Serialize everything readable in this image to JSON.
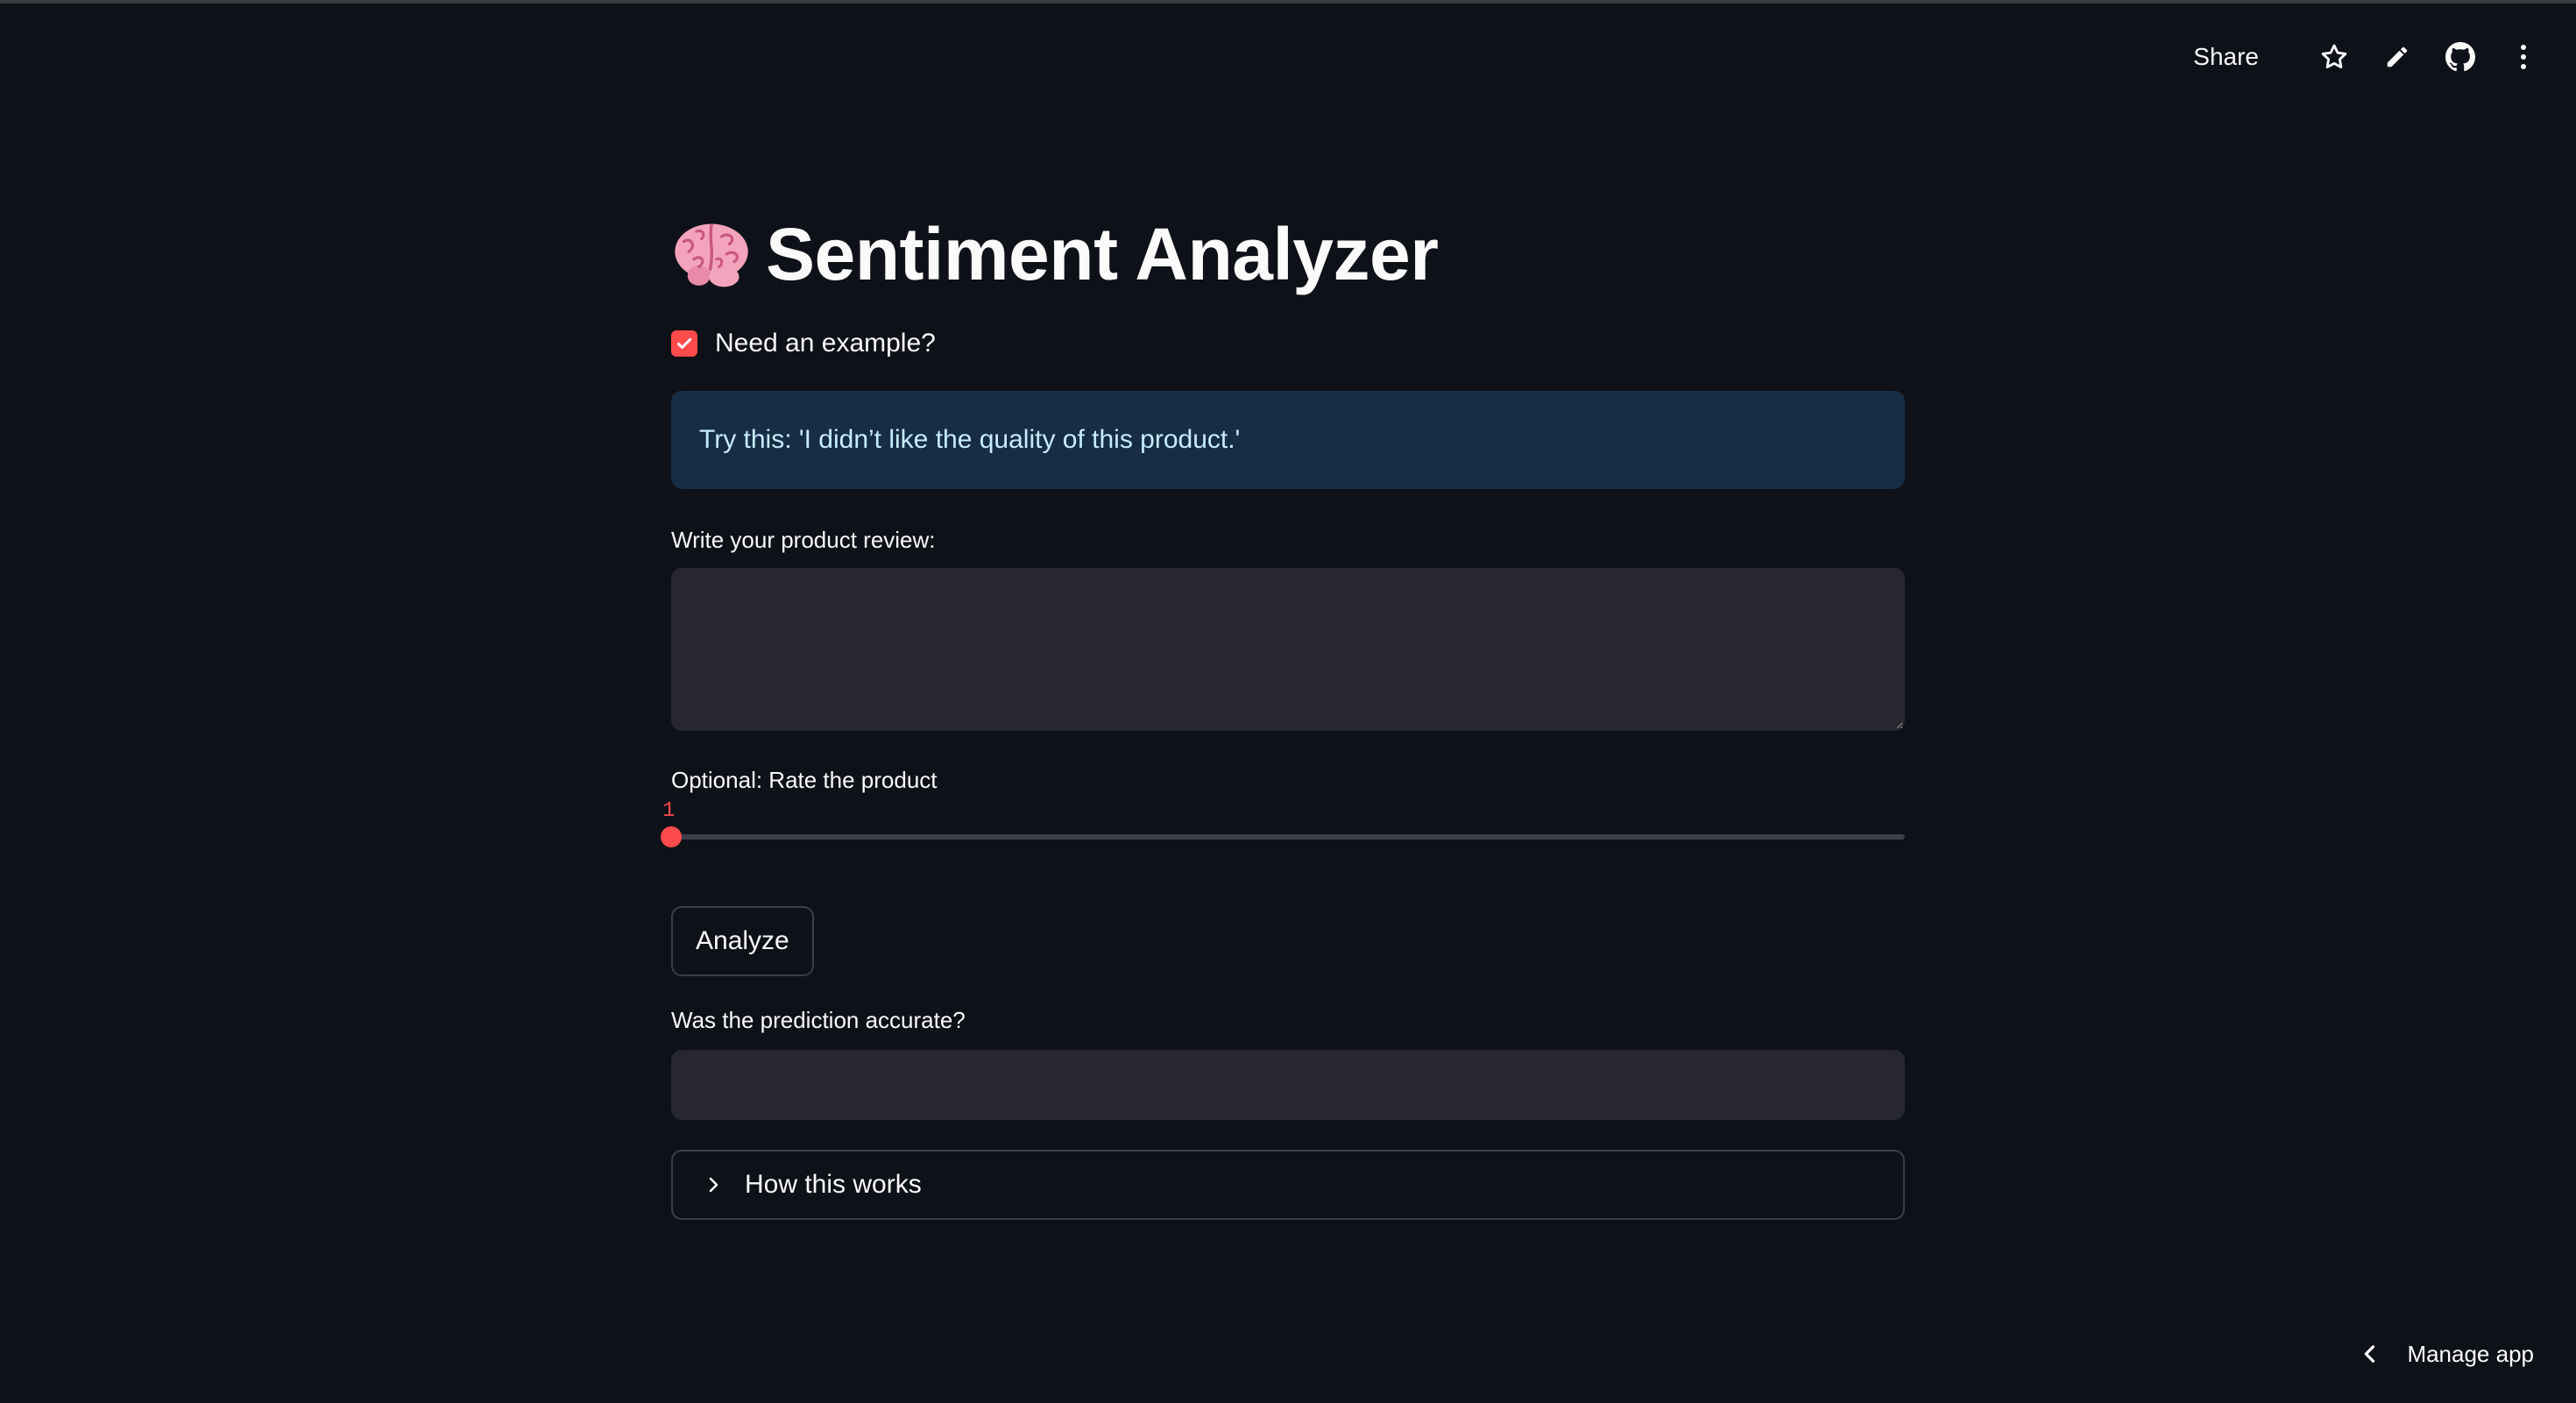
{
  "header": {
    "share_label": "Share",
    "icons": [
      "star-icon",
      "pencil-icon",
      "github-icon",
      "more-vertical-icon"
    ]
  },
  "app": {
    "title": "Sentiment Analyzer",
    "title_icon": "brain-emoji-icon"
  },
  "example_checkbox": {
    "label": "Need an example?",
    "checked": true
  },
  "info_box": {
    "text": "Try this: 'I didn’t like the quality of this product.'"
  },
  "review_input": {
    "label": "Write your product review:",
    "value": "",
    "placeholder": ""
  },
  "rating_slider": {
    "label": "Optional: Rate the product",
    "value": "1",
    "fraction": 0
  },
  "analyze_button": {
    "label": "Analyze"
  },
  "feedback": {
    "label": "Was the prediction accurate?",
    "value": ""
  },
  "expander": {
    "label": "How this works",
    "expanded": false
  },
  "footer": {
    "manage_app_label": "Manage app"
  },
  "colors": {
    "background": "#0e1117",
    "accent": "#ff4b4b",
    "info_bg": "#172d43",
    "info_text": "#c7ebff",
    "input_bg": "#262730"
  }
}
